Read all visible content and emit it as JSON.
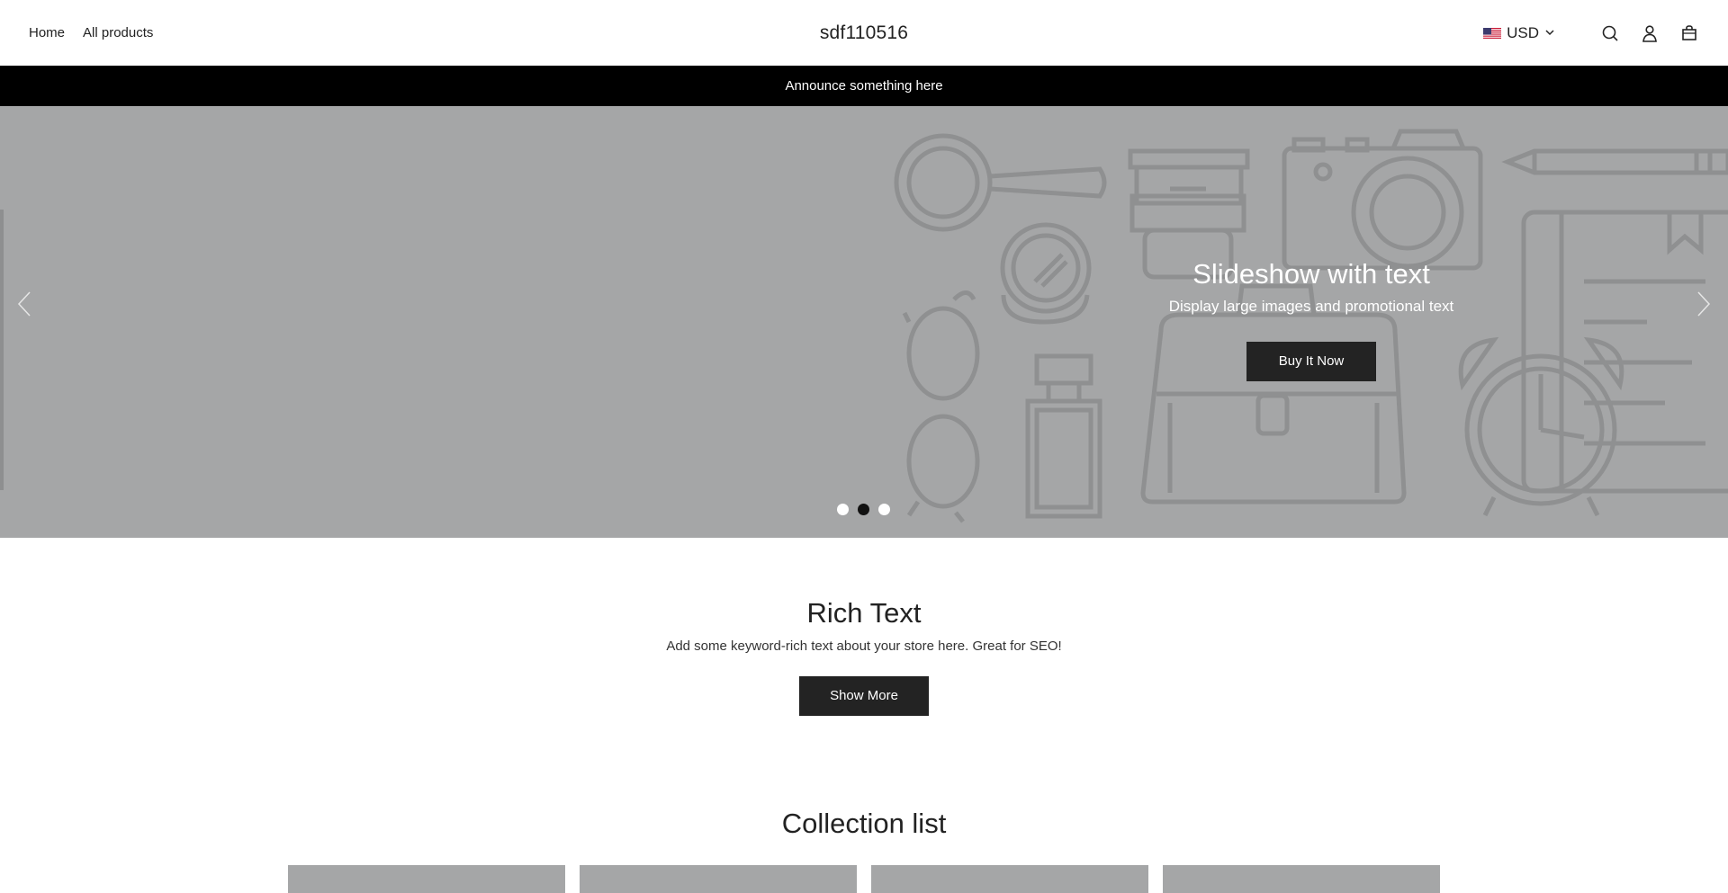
{
  "header": {
    "nav": [
      {
        "label": "Home"
      },
      {
        "label": "All products"
      }
    ],
    "brand": "sdf110516",
    "currency": {
      "code": "USD",
      "flag": "us-flag-icon"
    },
    "icons": [
      "search-icon",
      "account-icon",
      "cart-icon"
    ]
  },
  "announcement": "Announce something here",
  "slideshow": {
    "title": "Slideshow with text",
    "subtitle": "Display large images and promotional text",
    "button": "Buy It Now",
    "dots": 3,
    "active_dot": 2,
    "background_color": "#a5a6a7"
  },
  "rich_text": {
    "title": "Rich Text",
    "body": "Add some keyword-rich text about your store here. Great for SEO!",
    "button": "Show More"
  },
  "collection_list": {
    "title": "Collection list",
    "cards": 4
  },
  "colors": {
    "button_bg": "#232323",
    "announcement_bg": "#000000",
    "placeholder": "#a5a6a7"
  }
}
